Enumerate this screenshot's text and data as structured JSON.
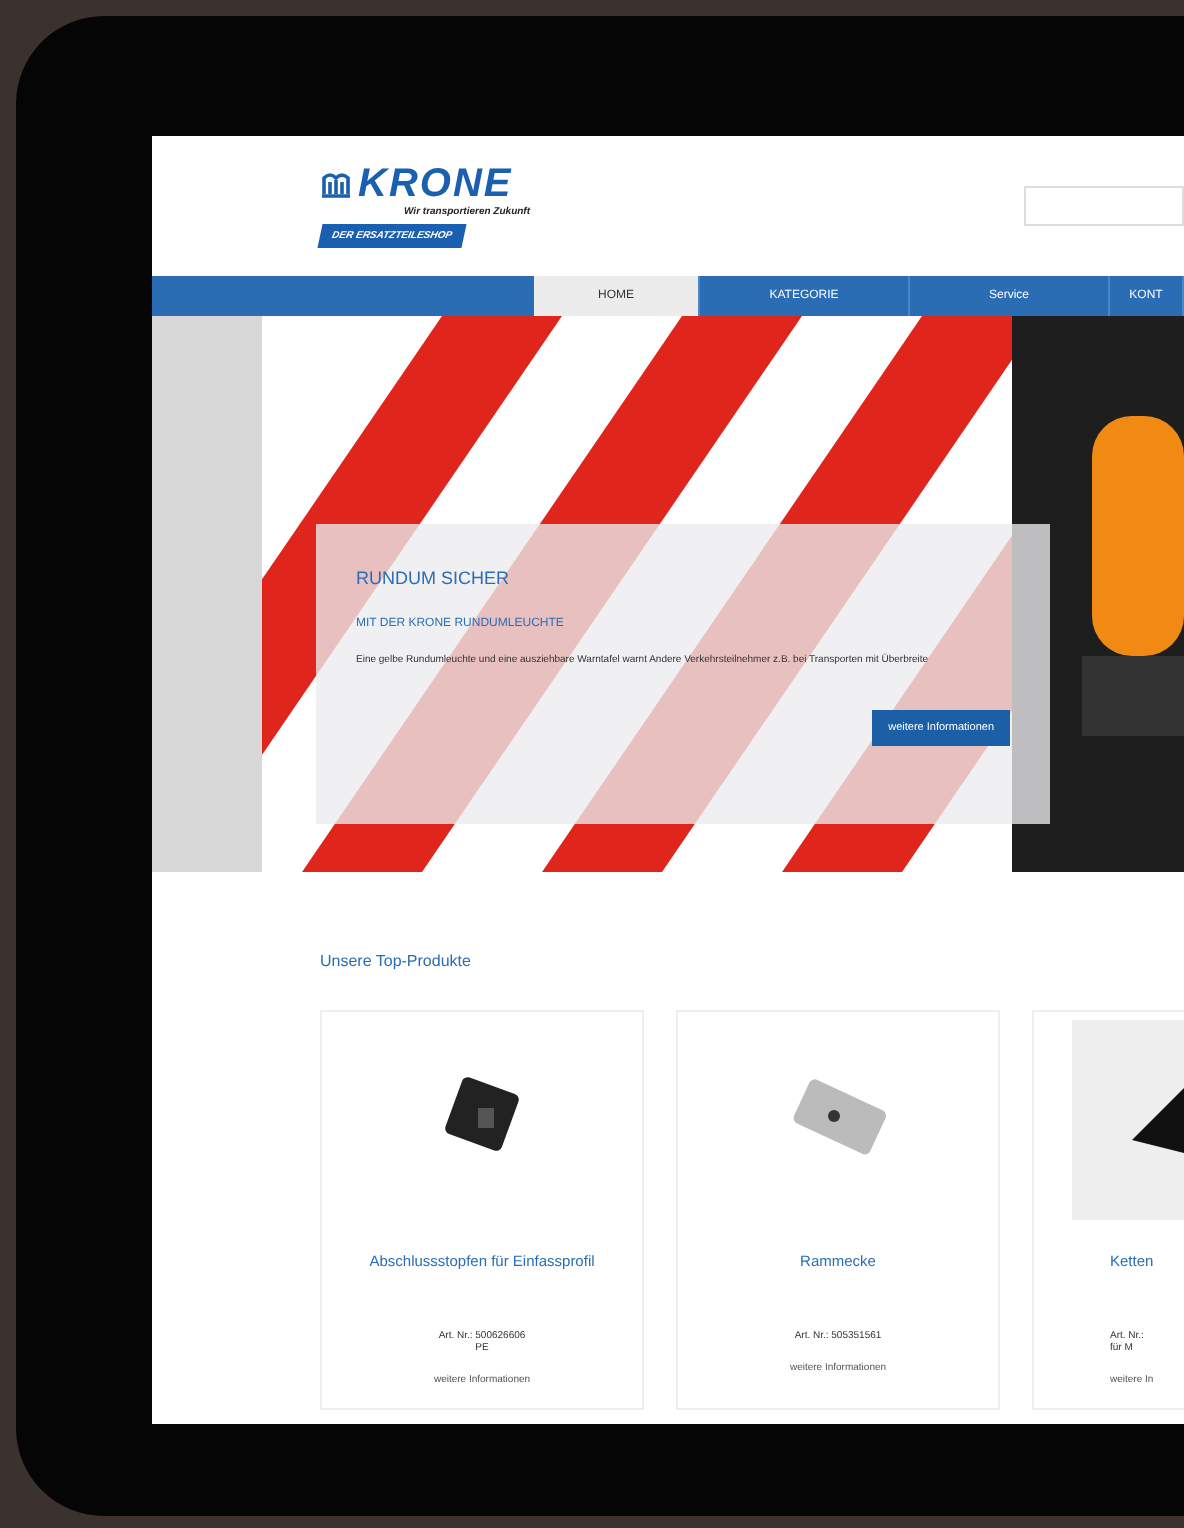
{
  "header": {
    "logo": {
      "brand": "KRONE",
      "tagline": "Wir transportieren Zukunft",
      "badge": "DER ERSATZTEILESHOP"
    }
  },
  "nav": {
    "tabs": [
      {
        "label": "HOME",
        "selected": true
      },
      {
        "label": "KATEGORIE",
        "selected": false
      },
      {
        "label": "Service",
        "selected": false
      },
      {
        "label": "KONT",
        "selected": false
      }
    ]
  },
  "hero": {
    "title": "RUNDUM SICHER",
    "subtitle": "MIT DER KRONE RUNDUMLEUCHTE",
    "text": "Eine gelbe Rundumleuchte und eine ausziehbare Warntafel warnt Andere Verkehrsteilnehmer z.B. bei Transporten mit Überbreite",
    "button": "weitere Informationen"
  },
  "products": {
    "heading": "Unsere Top-Produkte",
    "items": [
      {
        "kind": "plug",
        "name": "Abschlussstopfen für Einfassprofil",
        "article": "Art. Nr.: 500626606",
        "note": "PE",
        "link": "weitere Informationen"
      },
      {
        "kind": "block",
        "name": "Rammecke",
        "article": "Art. Nr.: 505351561",
        "link": "weitere Informationen"
      },
      {
        "kind": "bracket",
        "name": "Ketten",
        "article": "Art. Nr.:",
        "note": "für M",
        "link": "weitere In"
      }
    ]
  }
}
